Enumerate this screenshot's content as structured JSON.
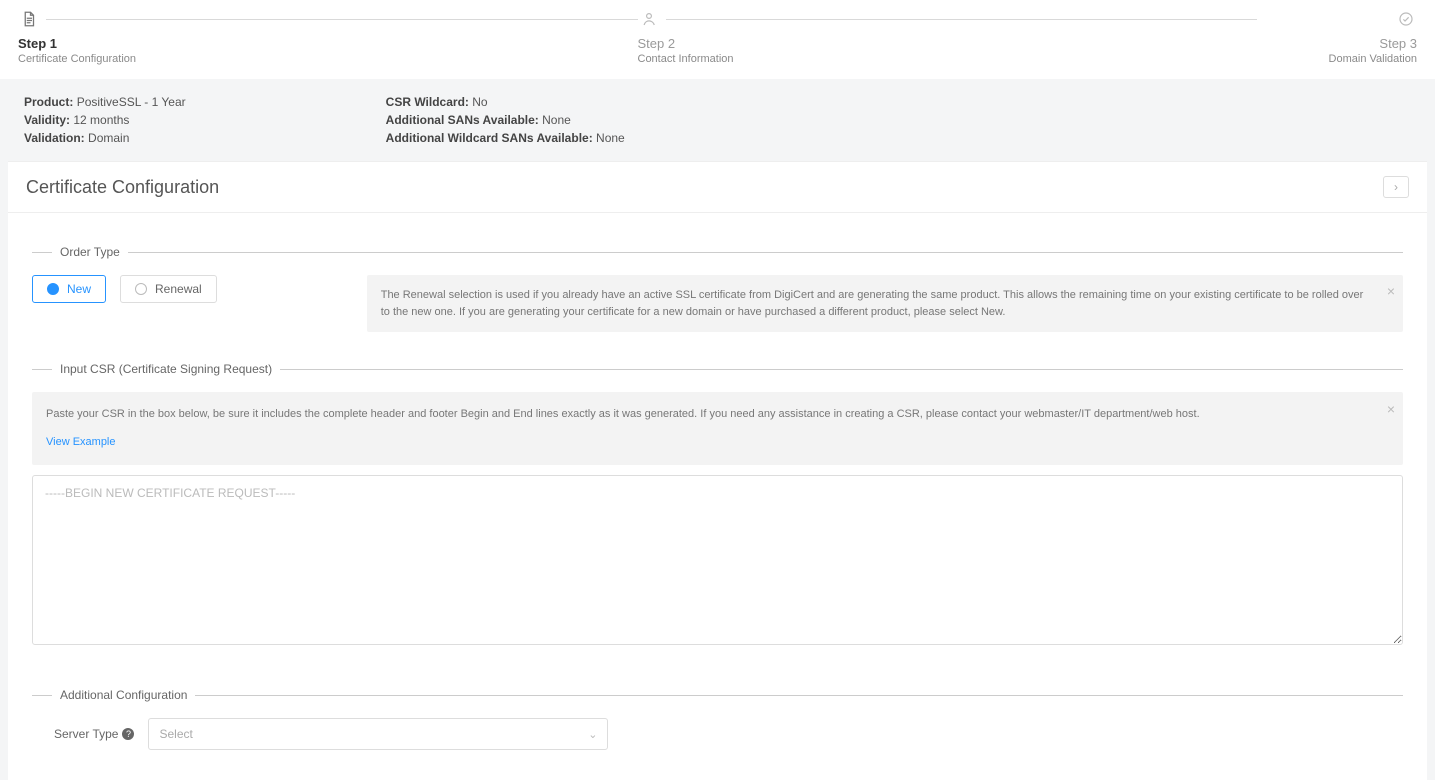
{
  "wizard": {
    "steps": [
      {
        "label": "Step 1",
        "sub": "Certificate Configuration",
        "icon": "document",
        "active": true
      },
      {
        "label": "Step 2",
        "sub": "Contact Information",
        "icon": "person",
        "active": false
      },
      {
        "label": "Step 3",
        "sub": "Domain Validation",
        "icon": "check",
        "active": false
      }
    ]
  },
  "summary": {
    "left": {
      "product_k": "Product:",
      "product_v": "PositiveSSL - 1 Year",
      "validity_k": "Validity:",
      "validity_v": "12 months",
      "validation_k": "Validation:",
      "validation_v": "Domain"
    },
    "right": {
      "wildcard_k": "CSR Wildcard:",
      "wildcard_v": "No",
      "sans_k": "Additional SANs Available:",
      "sans_v": "None",
      "wsans_k": "Additional Wildcard SANs Available:",
      "wsans_v": "None"
    }
  },
  "panel": {
    "title": "Certificate Configuration",
    "section_order_type": "Order Type",
    "section_csr": "Input CSR (Certificate Signing Request)",
    "section_addl": "Additional Configuration",
    "order_new": "New",
    "order_renewal": "Renewal",
    "renewal_info": "The Renewal selection is used if you already have an active SSL certificate from DigiCert and are generating the same product. This allows the remaining time on your existing certificate to be rolled over to the new one. If you are generating your certificate for a new domain or have purchased a different product, please select New.",
    "csr_instr": "Paste your CSR in the box below, be sure it includes the complete header and footer Begin and End lines exactly as it was generated. If you need any assistance in creating a CSR, please contact your webmaster/IT department/web host.",
    "view_example": "View Example",
    "csr_placeholder": "-----BEGIN NEW CERTIFICATE REQUEST-----",
    "server_type_label": "Server Type",
    "server_type_placeholder": "Select"
  }
}
